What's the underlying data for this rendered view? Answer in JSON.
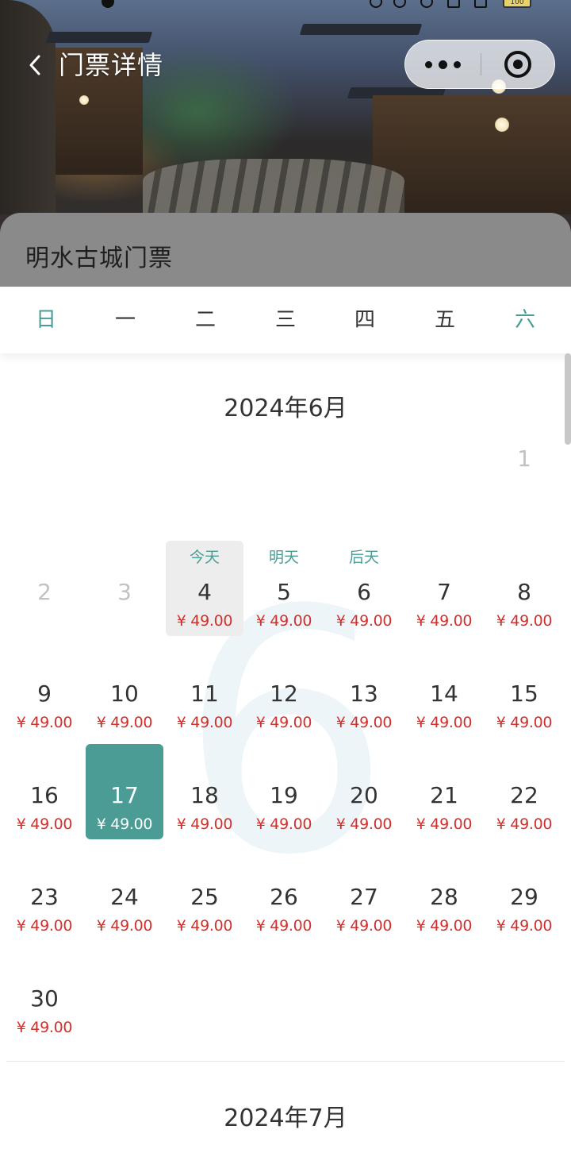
{
  "nav": {
    "title": "门票详情",
    "back_icon": "chevron-left-icon",
    "more_icon": "more-dots-icon",
    "close_icon": "target-circle-icon"
  },
  "status_bar": {
    "battery": "100"
  },
  "ticket": {
    "name": "明水古城门票"
  },
  "weekdays": [
    "日",
    "一",
    "二",
    "三",
    "四",
    "五",
    "六"
  ],
  "colors": {
    "accent": "#4a9c95",
    "price": "#d0312d",
    "today_bg": "#ededed"
  },
  "months": [
    {
      "title": "2024年6月",
      "watermark": "6",
      "days": [
        {
          "day": "1",
          "disabled": true
        },
        {
          "day": "2",
          "disabled": true
        },
        {
          "day": "3",
          "disabled": true
        },
        {
          "day": "4",
          "tag": "今天",
          "price": "¥ 49.00",
          "state": "today"
        },
        {
          "day": "5",
          "tag": "明天",
          "price": "¥ 49.00"
        },
        {
          "day": "6",
          "tag": "后天",
          "price": "¥ 49.00"
        },
        {
          "day": "7",
          "price": "¥ 49.00"
        },
        {
          "day": "8",
          "price": "¥ 49.00"
        },
        {
          "day": "9",
          "price": "¥ 49.00"
        },
        {
          "day": "10",
          "price": "¥ 49.00"
        },
        {
          "day": "11",
          "price": "¥ 49.00"
        },
        {
          "day": "12",
          "price": "¥ 49.00"
        },
        {
          "day": "13",
          "price": "¥ 49.00"
        },
        {
          "day": "14",
          "price": "¥ 49.00"
        },
        {
          "day": "15",
          "price": "¥ 49.00"
        },
        {
          "day": "16",
          "price": "¥ 49.00"
        },
        {
          "day": "17",
          "price": "¥ 49.00",
          "state": "selected"
        },
        {
          "day": "18",
          "price": "¥ 49.00"
        },
        {
          "day": "19",
          "price": "¥ 49.00"
        },
        {
          "day": "20",
          "price": "¥ 49.00"
        },
        {
          "day": "21",
          "price": "¥ 49.00"
        },
        {
          "day": "22",
          "price": "¥ 49.00"
        },
        {
          "day": "23",
          "price": "¥ 49.00"
        },
        {
          "day": "24",
          "price": "¥ 49.00"
        },
        {
          "day": "25",
          "price": "¥ 49.00"
        },
        {
          "day": "26",
          "price": "¥ 49.00"
        },
        {
          "day": "27",
          "price": "¥ 49.00"
        },
        {
          "day": "28",
          "price": "¥ 49.00"
        },
        {
          "day": "29",
          "price": "¥ 49.00"
        },
        {
          "day": "30",
          "price": "¥ 49.00"
        }
      ]
    },
    {
      "title": "2024年7月"
    }
  ]
}
